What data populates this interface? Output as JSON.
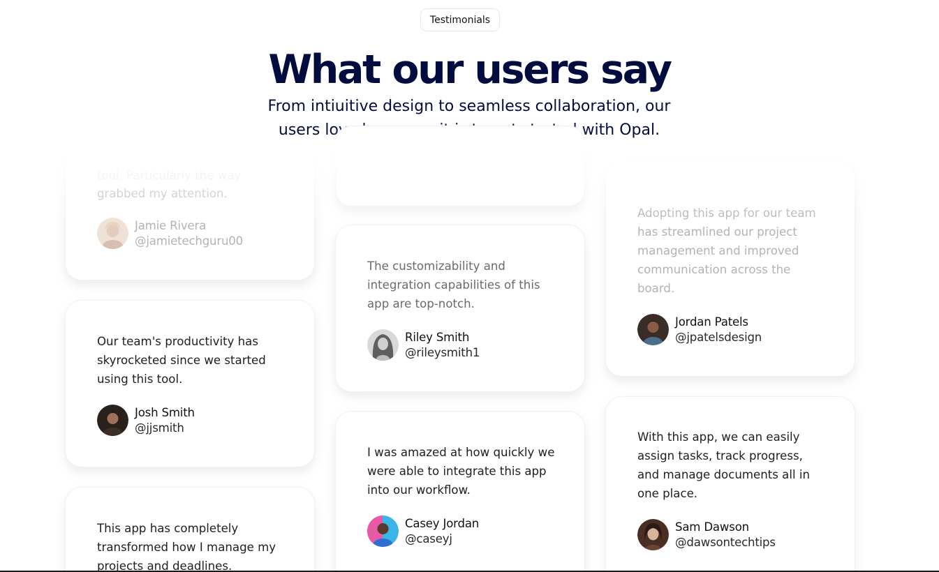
{
  "header": {
    "badge": "Testimonials",
    "title": "What our users say",
    "subtitle": "From intiuitive design to seamless collaboration, our users love how easy it is to get started with Opal."
  },
  "testimonials": {
    "col1": [
      {
        "quote": "grabbed my attention.",
        "partial_line": "tool. Particularly the way",
        "name": "Jamie Rivera",
        "handle": "@jamietechguru00",
        "avatar_color": "#c9a48c"
      },
      {
        "quote": "Our team's productivity has skyrocketed since we started using this tool.",
        "name": "Josh Smith",
        "handle": "@jjsmith",
        "avatar_color": "#3b2a22"
      },
      {
        "quote": "This app has completely transformed how I manage my projects and deadlines.",
        "name": "",
        "handle": "",
        "avatar_color": "#888888"
      }
    ],
    "col2": [
      {
        "quote": "The customizability and integration capabilities of this app are top-notch.",
        "name": "Riley Smith",
        "handle": "@rileysmith1",
        "avatar_color": "#6e6e6e"
      },
      {
        "quote": "I was amazed at how quickly we were able to integrate this app into our workflow.",
        "name": "Casey Jordan",
        "handle": "@caseyj",
        "avatar_color": "#e04f9c"
      }
    ],
    "col3": [
      {
        "quote": "Adopting this app for our team has streamlined our project management and improved communication across the board.",
        "name": "Jordan Patels",
        "handle": "@jpatelsdesign",
        "avatar_color": "#5a3b2c"
      },
      {
        "quote": "With this app, we can easily assign tasks, track progress, and manage documents all in one place.",
        "name": "Sam Dawson",
        "handle": "@dawsontechtips",
        "avatar_color": "#7a4a3a"
      }
    ]
  }
}
